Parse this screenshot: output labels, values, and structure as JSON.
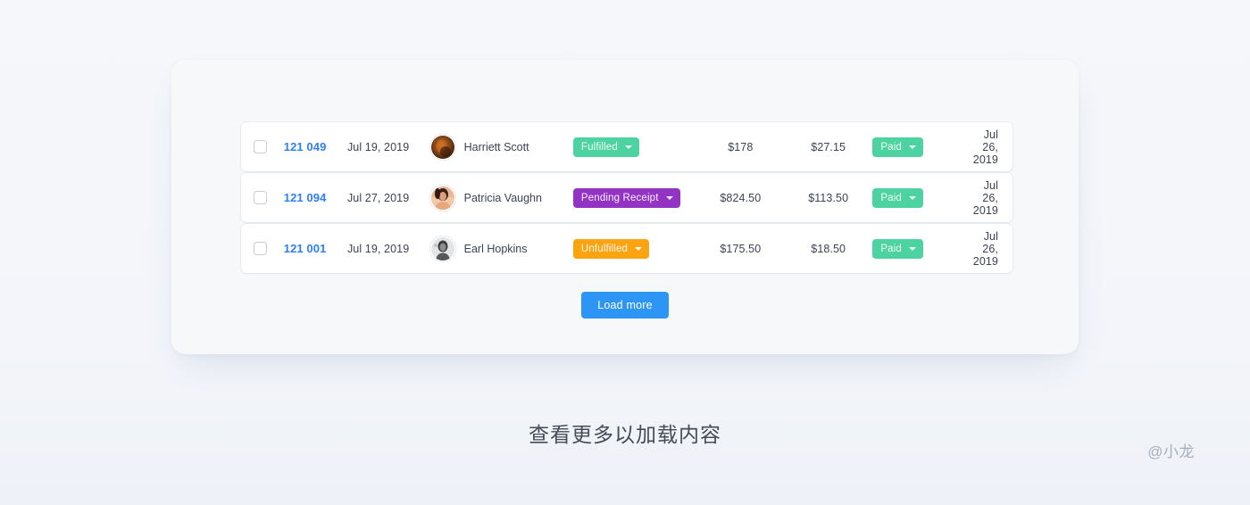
{
  "caption": "查看更多以加载内容",
  "watermark": "@小龙",
  "load_more_label": "Load more",
  "colors": {
    "link": "#2d7ff9",
    "fulfilled": "#4cd3a1",
    "pending": "#9333c4",
    "unfulfilled": "#fca311",
    "paid": "#4cd3a1",
    "button": "#2d95f3",
    "panel_bg": "#f7f8fa",
    "page_bg": "#f4f6fa"
  },
  "rows": [
    {
      "order": "121 049",
      "date": "Jul 19, 2019",
      "customer": "Harriett Scott",
      "avatar": "avatar-harriett-scott",
      "status": "Fulfilled",
      "status_color": "#4cd3a1",
      "total": "$178",
      "fee": "$27.15",
      "payment": "Paid",
      "payment_color": "#4cd3a1",
      "paid_date": "Jul 26, 2019"
    },
    {
      "order": "121 094",
      "date": "Jul 27, 2019",
      "customer": "Patricia Vaughn",
      "avatar": "avatar-patricia-vaughn",
      "status": "Pending Receipt",
      "status_color": "#9333c4",
      "total": "$824.50",
      "fee": "$113.50",
      "payment": "Paid",
      "payment_color": "#4cd3a1",
      "paid_date": "Jul 26, 2019"
    },
    {
      "order": "121 001",
      "date": "Jul 19, 2019",
      "customer": "Earl Hopkins",
      "avatar": "avatar-earl-hopkins",
      "status": "Unfulfilled",
      "status_color": "#fca311",
      "total": "$175.50",
      "fee": "$18.50",
      "payment": "Paid",
      "payment_color": "#4cd3a1",
      "paid_date": "Jul 26, 2019"
    }
  ]
}
